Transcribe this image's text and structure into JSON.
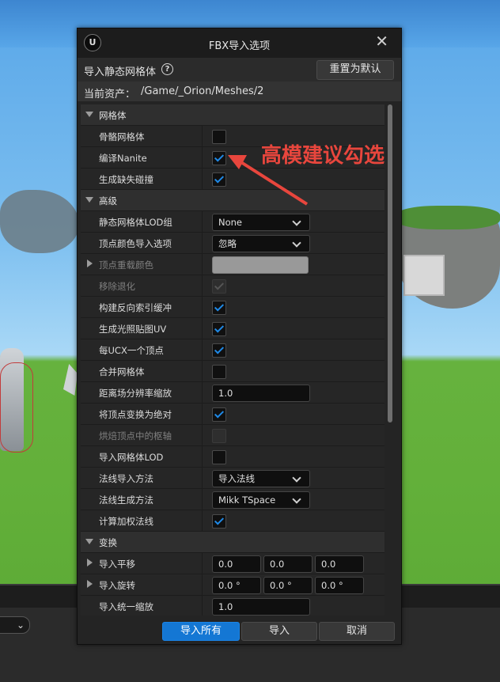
{
  "dialog": {
    "title": "FBX导入选项",
    "logo": "U",
    "close_icon": "✕",
    "header_label": "导入静态网格体",
    "help_icon": "?",
    "reset_button": "重置为默认",
    "asset_label": "当前资产：",
    "asset_path": "/Game/_Orion/Meshes/2"
  },
  "sections": {
    "mesh": "网格体",
    "advanced": "高级",
    "transform": "变换"
  },
  "rows": {
    "skeletal_mesh": {
      "label": "骨骼网格体",
      "checked": false
    },
    "build_nanite": {
      "label": "编译Nanite",
      "checked": true
    },
    "generate_missing_collision": {
      "label": "生成缺失碰撞",
      "checked": true
    },
    "lod_group": {
      "label": "静态网格体LOD组",
      "value": "None"
    },
    "vertex_color_option": {
      "label": "顶点颜色导入选项",
      "value": "忽略"
    },
    "vertex_override_color": {
      "label": "顶点重载颜色",
      "color": "#999999"
    },
    "remove_degenerates": {
      "label": "移除退化",
      "checked": true
    },
    "build_reversed_index": {
      "label": "构建反向索引缓冲",
      "checked": true
    },
    "generate_lightmap_uvs": {
      "label": "生成光照贴图UV",
      "checked": true
    },
    "one_convex_per_ucx": {
      "label": "每UCX一个顶点",
      "checked": true
    },
    "combine_meshes": {
      "label": "合并网格体",
      "checked": false
    },
    "distance_field_scale": {
      "label": "距离场分辨率缩放",
      "value": "1.0"
    },
    "transform_vertex_absolute": {
      "label": "将顶点变换为绝对",
      "checked": true
    },
    "bake_pivot": {
      "label": "烘焙顶点中的枢轴",
      "checked": false
    },
    "import_mesh_lods": {
      "label": "导入网格体LOD",
      "checked": false
    },
    "normal_import_method": {
      "label": "法线导入方法",
      "value": "导入法线"
    },
    "normal_generation_method": {
      "label": "法线生成方法",
      "value": "Mikk TSpace"
    },
    "compute_weighted_normals": {
      "label": "计算加权法线",
      "checked": true
    },
    "import_translation": {
      "label": "导入平移",
      "x": "0.0",
      "y": "0.0",
      "z": "0.0"
    },
    "import_rotation": {
      "label": "导入旋转",
      "x": "0.0 °",
      "y": "0.0 °",
      "z": "0.0 °"
    },
    "import_uniform_scale": {
      "label": "导入统一缩放",
      "value": "1.0"
    }
  },
  "footer": {
    "import_all": "导入所有",
    "import": "导入",
    "cancel": "取消"
  },
  "annotation": {
    "text": "高模建议勾选",
    "color": "#e8463d"
  },
  "colors": {
    "accent": "#1477d4",
    "check": "#1f8ae8",
    "panel": "#242424"
  }
}
